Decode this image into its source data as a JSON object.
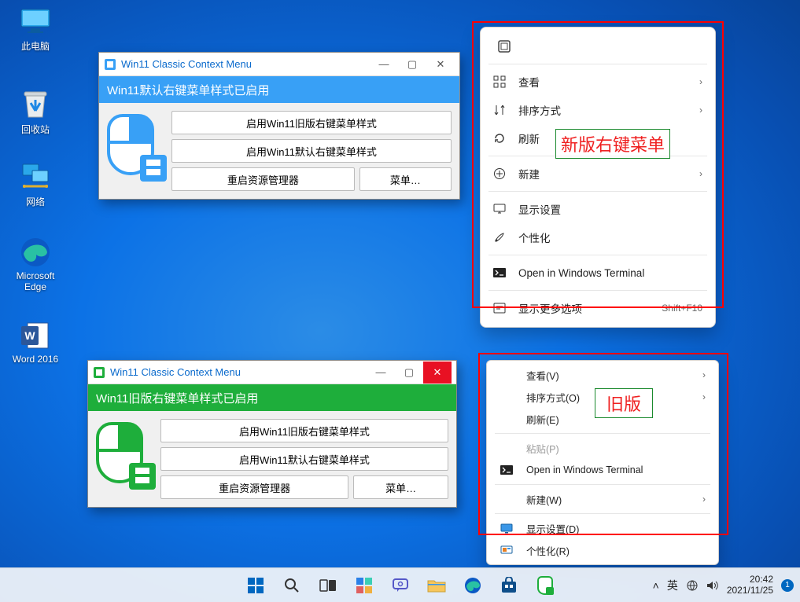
{
  "desktop_icons": {
    "this_pc": "此电脑",
    "recycle_bin": "回收站",
    "network": "网络",
    "edge": "Microsoft\nEdge",
    "word": "Word 2016"
  },
  "app_window_blue": {
    "title": "Win11 Classic Context Menu",
    "status": "Win11默认右键菜单样式已启用",
    "btn1": "启用Win11旧版右键菜单样式",
    "btn2": "启用Win11默认右键菜单样式",
    "btn3": "重启资源管理器",
    "btn4": "菜单…"
  },
  "app_window_green": {
    "title": "Win11 Classic Context Menu",
    "status": "Win11旧版右键菜单样式已启用",
    "btn1": "启用Win11旧版右键菜单样式",
    "btn2": "启用Win11默认右键菜单样式",
    "btn3": "重启资源管理器",
    "btn4": "菜单…"
  },
  "menu_new": {
    "view": "查看",
    "sort": "排序方式",
    "refresh": "刷新",
    "new": "新建",
    "display_settings": "显示设置",
    "personalize": "个性化",
    "terminal": "Open in Windows Terminal",
    "more": "显示更多选项",
    "more_shortcut": "Shift+F10"
  },
  "menu_classic": {
    "view": "查看(V)",
    "sort": "排序方式(O)",
    "refresh": "刷新(E)",
    "paste": "粘贴(P)",
    "terminal": "Open in Windows Terminal",
    "new": "新建(W)",
    "display_settings": "显示设置(D)",
    "personalize": "个性化(R)"
  },
  "annotations": {
    "new_label": "新版右键菜单",
    "old_label": "旧版"
  },
  "taskbar": {
    "ime": "英",
    "time": "20:42",
    "date": "2021/11/25",
    "notif_count": "1"
  }
}
